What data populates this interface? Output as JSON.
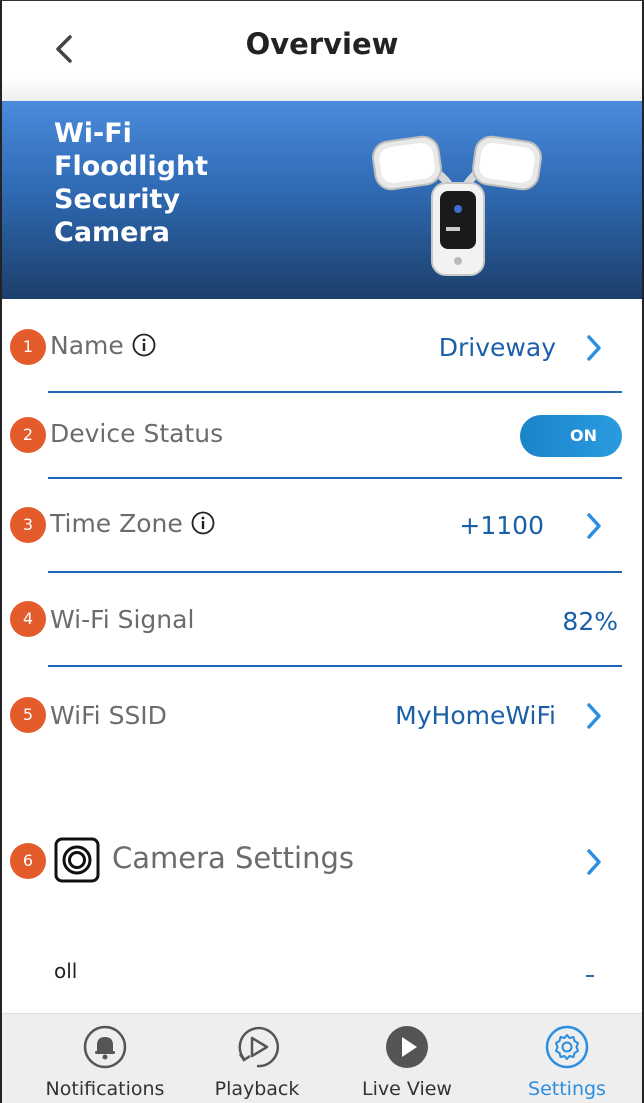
{
  "header": {
    "title": "Overview",
    "back_icon": "chevron-left-icon"
  },
  "banner": {
    "title_lines": [
      "Wi-Fi",
      "Floodlight",
      "Security",
      "Camera"
    ],
    "image": "floodlight-camera-image",
    "colors": {
      "top": "#4a8bdc",
      "bottom": "#1c3f6b"
    }
  },
  "rows": [
    {
      "badge": "1",
      "label": "Name",
      "value": "Driveway",
      "info_icon": true,
      "chevron": true
    },
    {
      "badge": "2",
      "label": "Device Status",
      "toggle": "ON"
    },
    {
      "badge": "3",
      "label": "Time Zone",
      "value": "+1100",
      "info_icon": true,
      "chevron": true
    },
    {
      "badge": "4",
      "label": "Wi-Fi Signal",
      "value": "82%"
    },
    {
      "badge": "5",
      "label": "WiFi SSID",
      "value": "MyHomeWiFi",
      "chevron": true
    }
  ],
  "camera_settings": {
    "badge": "6",
    "label": "Camera Settings",
    "icon": "camera-settings-icon"
  },
  "partial_next_item_icon": "oll",
  "tabbar": {
    "tabs": [
      {
        "label": "Notifications",
        "icon": "bell-icon",
        "active": false
      },
      {
        "label": "Playback",
        "icon": "playback-icon",
        "active": false
      },
      {
        "label": "Live View",
        "icon": "play-icon",
        "active": false
      },
      {
        "label": "Settings",
        "icon": "gear-icon",
        "active": true
      }
    ]
  },
  "colors": {
    "accent": "#1b5fa8",
    "badge": "#e35b2a",
    "toggle": "#1b84c9",
    "active_tab": "#2b8ee0"
  }
}
